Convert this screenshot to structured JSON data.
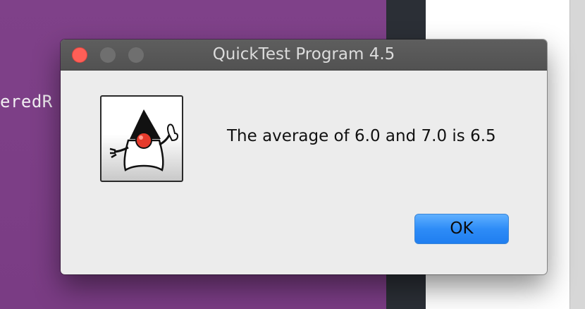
{
  "background": {
    "code_fragment": "eredR"
  },
  "dialog": {
    "title": "QuickTest Program 4.5",
    "message": "The average of 6.0 and 7.0 is 6.5",
    "ok_label": "OK",
    "icon": "java-duke-icon"
  },
  "colors": {
    "accent": "#2e8cf7",
    "close": "#ff5f57",
    "background_purple": "#7f4189"
  }
}
